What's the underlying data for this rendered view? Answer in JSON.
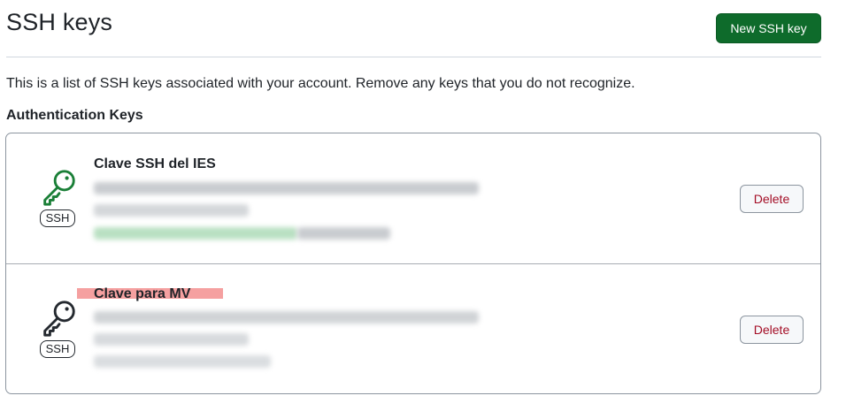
{
  "page": {
    "title": "SSH keys",
    "new_key_button": "New SSH key",
    "description": "This is a list of SSH keys associated with your account. Remove any keys that you do not recognize.",
    "section_title": "Authentication Keys"
  },
  "keys": [
    {
      "title": "Clave SSH del IES",
      "badge": "SSH",
      "delete_label": "Delete",
      "icon": "key-icon",
      "icon_color": "#1a7f37"
    },
    {
      "title": "Clave para MV",
      "badge": "SSH",
      "delete_label": "Delete",
      "icon": "key-icon",
      "icon_color": "#24292f"
    }
  ],
  "colors": {
    "primary_button": "#0e6b2b",
    "danger_text": "#a40e26",
    "highlight": "#f5a0a0"
  }
}
